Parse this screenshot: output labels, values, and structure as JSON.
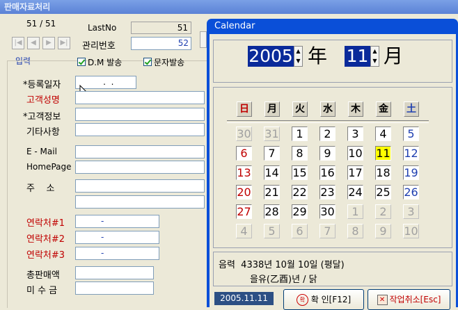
{
  "main": {
    "title": "판매자료처리",
    "record_count": "51 / 51",
    "lastno_label": "LastNo",
    "lastno_value": "51",
    "manage_label": "관리번호",
    "manage_value": "52",
    "section_label": "입력",
    "dm_label": "D.M 발송",
    "sms_label": "문자발송",
    "fields": {
      "reg_date_label": "*등록일자",
      "reg_date_value": "  .  .",
      "name_label": "고객성명",
      "info_label": "*고객정보",
      "misc_label": "기타사항",
      "email_label": "E - Mail",
      "homepage_label": "HomePage",
      "address_label": "주    소",
      "contact1_label": "연락처#1",
      "contact1_value": "-",
      "contact2_label": "연락처#2",
      "contact2_value": "-",
      "contact3_label": "연락처#3",
      "contact3_value": "-",
      "total_sales_label": "총판매액",
      "unpaid_label": "미 수 금"
    }
  },
  "calendar": {
    "title": "Calendar",
    "year": "2005",
    "year_unit": "年",
    "month": "11",
    "month_unit": "月",
    "weekdays": [
      "日",
      "月",
      "火",
      "水",
      "木",
      "金",
      "土"
    ],
    "weeks": [
      [
        {
          "d": "30",
          "o": true
        },
        {
          "d": "31",
          "o": true
        },
        {
          "d": "1"
        },
        {
          "d": "2"
        },
        {
          "d": "3"
        },
        {
          "d": "4"
        },
        {
          "d": "5"
        }
      ],
      [
        {
          "d": "6"
        },
        {
          "d": "7"
        },
        {
          "d": "8"
        },
        {
          "d": "9"
        },
        {
          "d": "10"
        },
        {
          "d": "11",
          "t": true
        },
        {
          "d": "12"
        }
      ],
      [
        {
          "d": "13"
        },
        {
          "d": "14"
        },
        {
          "d": "15"
        },
        {
          "d": "16"
        },
        {
          "d": "17"
        },
        {
          "d": "18"
        },
        {
          "d": "19"
        }
      ],
      [
        {
          "d": "20"
        },
        {
          "d": "21"
        },
        {
          "d": "22"
        },
        {
          "d": "23"
        },
        {
          "d": "24"
        },
        {
          "d": "25"
        },
        {
          "d": "26"
        }
      ],
      [
        {
          "d": "27"
        },
        {
          "d": "28"
        },
        {
          "d": "29"
        },
        {
          "d": "30"
        },
        {
          "d": "1",
          "o": true
        },
        {
          "d": "2",
          "o": true
        },
        {
          "d": "3",
          "o": true
        }
      ],
      [
        {
          "d": "4",
          "o": true
        },
        {
          "d": "5",
          "o": true
        },
        {
          "d": "6",
          "o": true
        },
        {
          "d": "7",
          "o": true
        },
        {
          "d": "8",
          "o": true
        },
        {
          "d": "9",
          "o": true
        },
        {
          "d": "10",
          "o": true
        }
      ]
    ],
    "lunar_line1": "음력  4338년 10월 10일 (평달)",
    "lunar_line2": "을유(乙酉)년 / 닭",
    "selected_date": "2005.11.11",
    "ok_label": "확 인[F12]",
    "cancel_label": "작업취소[Esc]",
    "colors": {
      "sunday": "#c00000",
      "saturday": "#1f3fb0",
      "today": "#ffff00",
      "selection": "#0a2a9a"
    }
  }
}
